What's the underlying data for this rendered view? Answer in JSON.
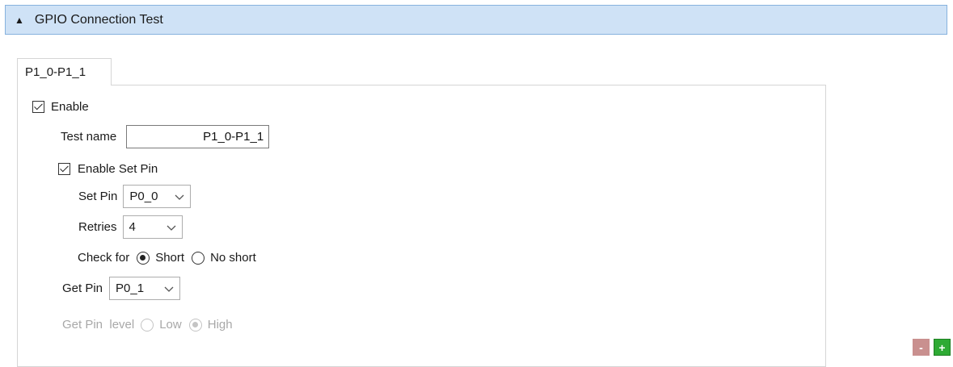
{
  "header": {
    "toggle_glyph": "▲",
    "title": "GPIO Connection Test",
    "background": "#cfe2f6"
  },
  "tabs": [
    {
      "label": "P1_0-P1_1",
      "selected": true
    }
  ],
  "form": {
    "enable_label": "Enable",
    "enable_checked": true,
    "test_name_label": "Test name",
    "test_name_value": "P1_0-P1_1",
    "enable_set_pin_label": "Enable Set Pin",
    "enable_set_pin_checked": true,
    "set_pin_label": "Set Pin",
    "set_pin_value": "P0_0",
    "retries_label": "Retries",
    "retries_value": "4",
    "check_for_label": "Check for",
    "check_for_options": [
      "Short",
      "No short"
    ],
    "check_for_selected": "Short",
    "get_pin_label": "Get Pin",
    "get_pin_value": "P0_1",
    "get_pin_level_label": "Get Pin  level",
    "get_pin_level_options": [
      "Low",
      "High"
    ],
    "get_pin_level_selected": "High",
    "get_pin_level_enabled": false
  },
  "buttons": {
    "remove_label": "-",
    "remove_color": "#c9908f",
    "add_label": "+",
    "add_color": "#2eaa34"
  }
}
